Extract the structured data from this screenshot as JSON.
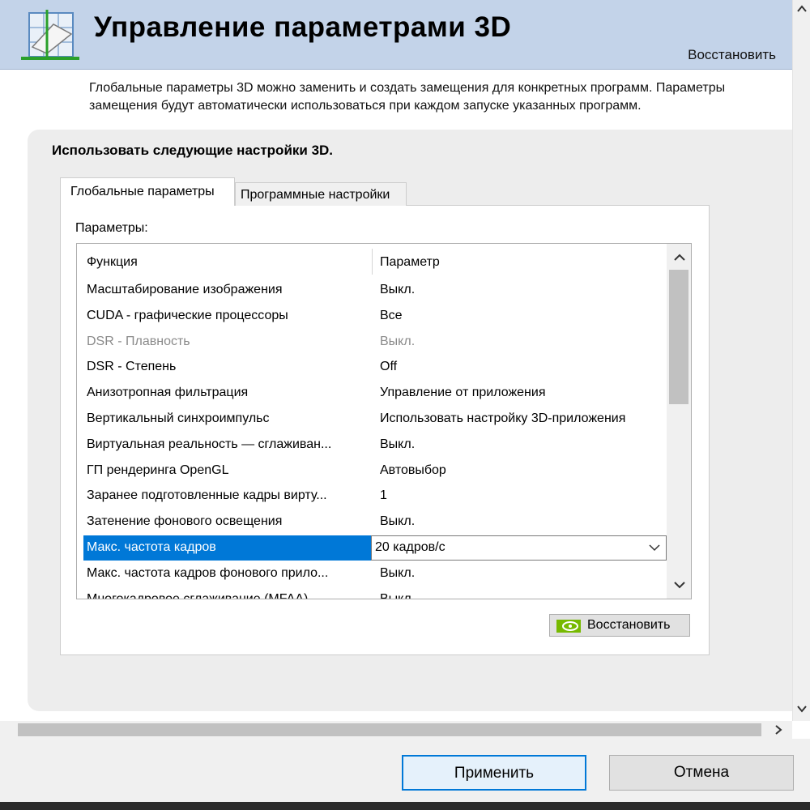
{
  "header": {
    "title": "Управление параметрами 3D",
    "restore_link": "Восстановить"
  },
  "description": {
    "line1": "Глобальные параметры 3D можно заменить и создать замещения для конкретных программ. Параметры",
    "line2": "замещения будут автоматически использоваться при каждом запуске указанных программ."
  },
  "settings": {
    "section_title": "Использовать следующие настройки 3D.",
    "tabs": [
      {
        "label": "Глобальные параметры",
        "active": true
      },
      {
        "label": "Программные настройки",
        "active": false
      }
    ],
    "params_label": "Параметры:",
    "table": {
      "headers": {
        "function": "Функция",
        "parameter": "Параметр"
      },
      "rows": [
        {
          "function": "Масштабирование изображения",
          "parameter": "Выкл."
        },
        {
          "function": "CUDA - графические процессоры",
          "parameter": "Все"
        },
        {
          "function": "DSR - Плавность",
          "parameter": "Выкл."
        },
        {
          "function": "DSR - Степень",
          "parameter": "Off"
        },
        {
          "function": "Анизотропная фильтрация",
          "parameter": "Управление от приложения"
        },
        {
          "function": "Вертикальный синхроимпульс",
          "parameter": "Использовать настройку 3D-приложения"
        },
        {
          "function": "Виртуальная реальность — сглаживан...",
          "parameter": "Выкл."
        },
        {
          "function": "ГП рендеринга OpenGL",
          "parameter": "Автовыбор"
        },
        {
          "function": "Заранее подготовленные кадры вирту...",
          "parameter": "1"
        },
        {
          "function": "Затенение фонового освещения",
          "parameter": "Выкл."
        },
        {
          "function": "Макс. частота кадров",
          "parameter": "20 кадров/с"
        },
        {
          "function": "Макс. частота кадров фонового прило...",
          "parameter": "Выкл."
        },
        {
          "function": "Многокадровое сглаживание (MFAA)",
          "parameter": "Выкл."
        }
      ]
    },
    "restore_button": "Восстановить"
  },
  "footer": {
    "apply": "Применить",
    "cancel": "Отмена"
  },
  "colors": {
    "header_bg": "#c3d3e9",
    "selection": "#0078d7",
    "nvidia_green": "#76b900"
  },
  "icons": [
    "3d-cube-icon",
    "nvidia-logo-icon",
    "chevron-down-icon",
    "chevron-up-icon",
    "arrow-up-icon",
    "arrow-down-icon",
    "arrow-right-icon"
  ]
}
